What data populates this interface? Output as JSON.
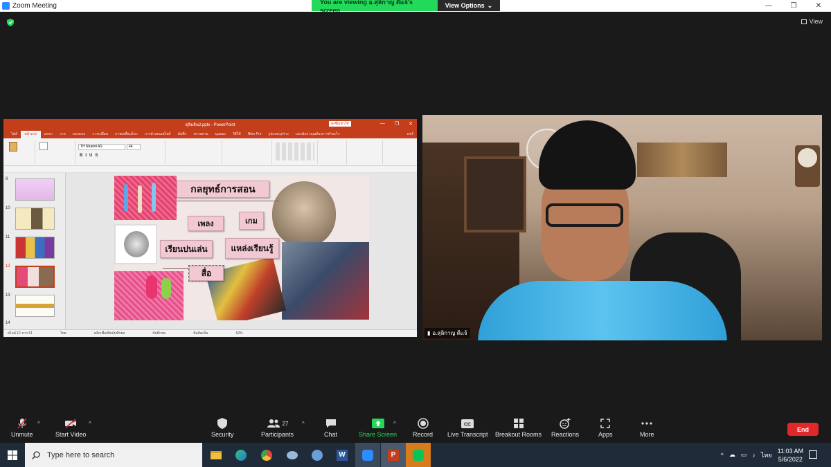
{
  "window": {
    "title": "Zoom Meeting",
    "minimize": "—",
    "restore": "❐",
    "close": "✕"
  },
  "banner": {
    "viewing_text": "You are viewing อ.สุลิกาญ ดีแจ้'s screen",
    "view_options": "View Options",
    "view_options_caret": "⌄"
  },
  "view_button": {
    "label": "View"
  },
  "ppt": {
    "title": "ดุลิมลิน2.pptx - PowerPoint",
    "title_badge": "ลงชื่อเข้าใช้",
    "tabs": [
      "ไฟล์",
      "หน้าแรก",
      "แทรก",
      "วาด",
      "ออกแบบ",
      "การเปลี่ยน",
      "ภาพเคลื่อนไหว",
      "การนำเสนอสไลด์",
      "บันทึก",
      "ตรวจทาน",
      "มุมมอง",
      "วิธีใช้",
      "Nitro Pro",
      "รูปแบบรูปร่าง"
    ],
    "tell_me": "บอกฉันว่าคุณต้องการทำอะไร",
    "share": "แชร์",
    "font_name": "TH Niramit AS",
    "font_size": "44",
    "thumb_numbers": [
      "9",
      "10",
      "11",
      "12",
      "13",
      "14"
    ],
    "status_left": "สไลด์ 12 จาก 61",
    "status_lang": "ไทย",
    "status_notes": "บันทึกย่อ",
    "status_comments": "ข้อคิดเห็น",
    "zoom_level": "62%",
    "status_hint": "คลิกเพื่อเพิ่มบันทึกย่อ"
  },
  "slide": {
    "title": "กลยุทธ์การสอน",
    "items": {
      "song": "เพลง",
      "game": "เกม",
      "play": "เรียนปนเล่น",
      "source": "แหล่งเรียนรู้",
      "media": "สื่อ"
    }
  },
  "video": {
    "participant_name": "อ.สุลิกาญ ดีแจ้"
  },
  "toolbar": {
    "unmute": "Unmute",
    "start_video": "Start Video",
    "security": "Security",
    "participants": "Participants",
    "participants_count": "27",
    "chat": "Chat",
    "share_screen": "Share Screen",
    "record": "Record",
    "live_transcript": "Live Transcript",
    "breakout_rooms": "Breakout Rooms",
    "reactions": "Reactions",
    "apps": "Apps",
    "more": "More",
    "end": "End",
    "caret": "^"
  },
  "taskbar": {
    "search_placeholder": "Type here to search",
    "language": "ไทย",
    "time": "11:03 AM",
    "date": "5/6/2022"
  },
  "colors": {
    "zoom_blue": "#2d8cff",
    "zoom_green": "#23d95a",
    "end_red": "#e02828",
    "ppt_red": "#c43e1c",
    "pill_pink": "#f2c9d2"
  }
}
